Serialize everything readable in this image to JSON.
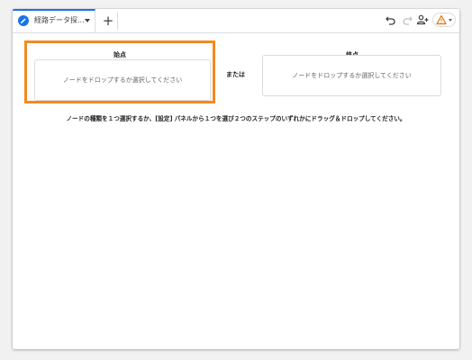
{
  "tabbar": {
    "tab_label": "経路データ探...",
    "add_tab_label": "+"
  },
  "canvas": {
    "start_label": "始点",
    "end_label": "終点",
    "or_label": "または",
    "start_placeholder": "ノードをドロップするか選択してください",
    "end_placeholder": "ノードをドロップするか選択してください",
    "instruction": "ノードの種類を１つ選択するか、[設定] パネルから１つを選び２つのステップのいずれかにドラッグ＆ドロップしてください。"
  },
  "colors": {
    "accent": "#1a73e8",
    "highlight": "#f28a22",
    "warning": "#e37400"
  },
  "icons": [
    "pencil-icon",
    "chevron-down-icon",
    "plus-icon",
    "undo-icon",
    "redo-icon",
    "share-user-icon",
    "warning-icon"
  ]
}
